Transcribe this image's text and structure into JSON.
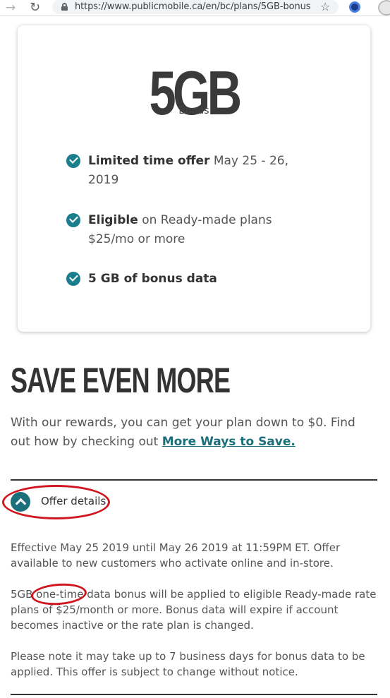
{
  "browser": {
    "url": "https://www.publicmobile.ca/en/bc/plans/5GB-bonus",
    "forward_icon": "arrow-right-icon",
    "reload_icon": "reload-icon",
    "lock_icon": "lock-icon",
    "bookmark_icon": "star-icon"
  },
  "card": {
    "headline": "5GB",
    "subheadline": "Bonus",
    "items": [
      {
        "bold": "Limited time offer",
        "text": " May 25 - 26, 2019"
      },
      {
        "bold": "Eligible",
        "text": "  on Ready-made plans $25/mo or more"
      },
      {
        "bold": "5 GB of bonus data",
        "text": ""
      }
    ]
  },
  "save": {
    "title": "SAVE EVEN MORE",
    "text": "With our rewards, you can get your plan down to $0. Find out how by checking out ",
    "link": "More Ways to Save."
  },
  "offer": {
    "label": "Offer details",
    "paragraphs": [
      "Effective May 25 2019 until May 26 2019 at 11:59PM ET. Offer available to new customers who activate online and in-store.",
      "5GB one-time data bonus will be applied to eligible Ready-made rate plans of $25/month or more. Bonus data will expire if account becomes inactive or the rate plan is changed.",
      "Please note it may take up to 7 business days for bonus data to be applied. This offer is subject to change without notice."
    ]
  },
  "colors": {
    "accent": "#1b7e8c",
    "annotation": "#d0161e",
    "heading": "#333333"
  }
}
